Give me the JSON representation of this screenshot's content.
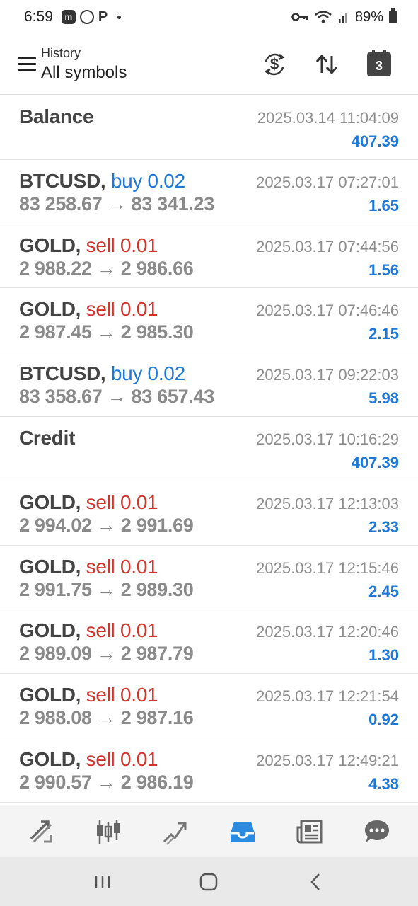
{
  "status_bar": {
    "time": "6:59",
    "battery": "89%"
  },
  "header": {
    "subtitle": "History",
    "title": "All symbols",
    "calendar_day": "3"
  },
  "records": [
    {
      "symbol": "Balance",
      "direction": "",
      "direction_type": "",
      "prices": "",
      "timestamp": "2025.03.14 11:04:09",
      "amount": "407.39"
    },
    {
      "symbol": "BTCUSD,",
      "direction": " buy 0.02",
      "direction_type": "buy",
      "prices": "83 258.67 → 83 341.23",
      "timestamp": "2025.03.17 07:27:01",
      "amount": "1.65"
    },
    {
      "symbol": "GOLD,",
      "direction": " sell 0.01",
      "direction_type": "sell",
      "prices": "2 988.22 → 2 986.66",
      "timestamp": "2025.03.17 07:44:56",
      "amount": "1.56"
    },
    {
      "symbol": "GOLD,",
      "direction": " sell 0.01",
      "direction_type": "sell",
      "prices": "2 987.45 → 2 985.30",
      "timestamp": "2025.03.17 07:46:46",
      "amount": "2.15"
    },
    {
      "symbol": "BTCUSD,",
      "direction": " buy 0.02",
      "direction_type": "buy",
      "prices": "83 358.67 → 83 657.43",
      "timestamp": "2025.03.17 09:22:03",
      "amount": "5.98"
    },
    {
      "symbol": "Credit",
      "direction": "",
      "direction_type": "",
      "prices": "",
      "timestamp": "2025.03.17 10:16:29",
      "amount": "407.39"
    },
    {
      "symbol": "GOLD,",
      "direction": " sell 0.01",
      "direction_type": "sell",
      "prices": "2 994.02 → 2 991.69",
      "timestamp": "2025.03.17 12:13:03",
      "amount": "2.33"
    },
    {
      "symbol": "GOLD,",
      "direction": " sell 0.01",
      "direction_type": "sell",
      "prices": "2 991.75 → 2 989.30",
      "timestamp": "2025.03.17 12:15:46",
      "amount": "2.45"
    },
    {
      "symbol": "GOLD,",
      "direction": " sell 0.01",
      "direction_type": "sell",
      "prices": "2 989.09 → 2 987.79",
      "timestamp": "2025.03.17 12:20:46",
      "amount": "1.30"
    },
    {
      "symbol": "GOLD,",
      "direction": " sell 0.01",
      "direction_type": "sell",
      "prices": "2 988.08 → 2 987.16",
      "timestamp": "2025.03.17 12:21:54",
      "amount": "0.92"
    },
    {
      "symbol": "GOLD,",
      "direction": " sell 0.01",
      "direction_type": "sell",
      "prices": "2 990.57 → 2 986.19",
      "timestamp": "2025.03.17 12:49:21",
      "amount": "4.38"
    }
  ],
  "bottom_nav": [
    {
      "icon": "quotes-icon",
      "active": false
    },
    {
      "icon": "chart-icon",
      "active": false
    },
    {
      "icon": "trade-icon",
      "active": false
    },
    {
      "icon": "history-icon",
      "active": true
    },
    {
      "icon": "news-icon",
      "active": false
    },
    {
      "icon": "messages-icon",
      "active": false
    }
  ],
  "colors": {
    "buy": "#1e78d8",
    "sell": "#d0342c",
    "amount": "#1e78d8",
    "active_nav": "#2a8be0"
  }
}
